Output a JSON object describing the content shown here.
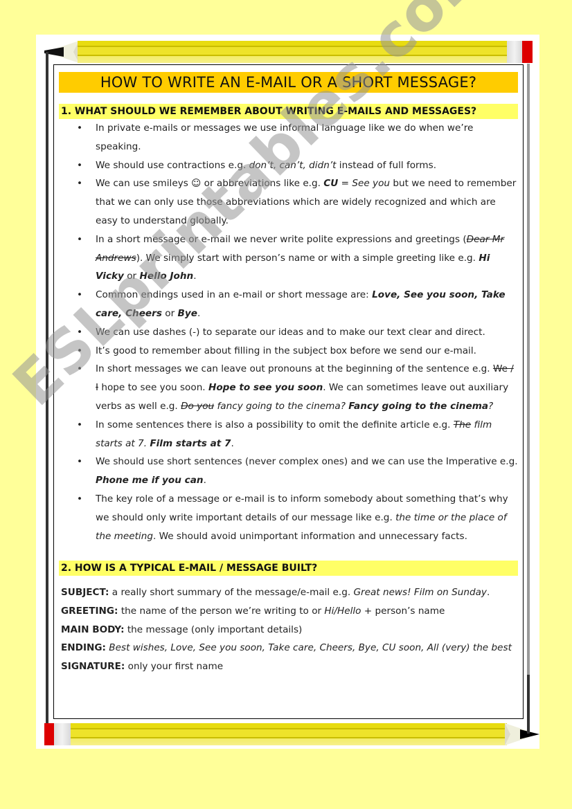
{
  "title": "HOW TO WRITE AN E-MAIL OR A SHORT MESSAGE?",
  "section1": {
    "heading": "1. WHAT SHOULD WE REMEMBER ABOUT WRITING E-MAILS AND MESSAGES?",
    "bullets": [
      {
        "parts": [
          {
            "t": "In private e-mails or messages we use informal language like we do when we’re speaking.",
            "s": "n"
          }
        ]
      },
      {
        "parts": [
          {
            "t": "We should use contractions e.g. ",
            "s": "n"
          },
          {
            "t": "don’t, can’t, didn’t",
            "s": "i"
          },
          {
            "t": " instead of full forms.",
            "s": "n"
          }
        ]
      },
      {
        "parts": [
          {
            "t": "We can use smileys ☺ or abbreviations like e.g. ",
            "s": "n"
          },
          {
            "t": "CU",
            "s": "bi"
          },
          {
            "t": " = ",
            "s": "n"
          },
          {
            "t": "See you",
            "s": "i"
          },
          {
            "t": " but we need to remember that we can only use those abbreviations which are widely recognized and which are easy to understand globally.",
            "s": "n"
          }
        ]
      },
      {
        "parts": [
          {
            "t": "In a short message or e-mail we never write polite expressions and greetings (",
            "s": "n"
          },
          {
            "t": "Dear Mr Andrews",
            "s": "strike"
          },
          {
            "t": "). We simply start with person’s name or with a simple greeting like e.g. ",
            "s": "n"
          },
          {
            "t": "Hi Vicky",
            "s": "bi"
          },
          {
            "t": " or ",
            "s": "n"
          },
          {
            "t": "Hello John",
            "s": "bi"
          },
          {
            "t": ".",
            "s": "n"
          }
        ]
      },
      {
        "parts": [
          {
            "t": "Common endings used in an e-mail or short message are: ",
            "s": "n"
          },
          {
            "t": "Love",
            "s": "bi"
          },
          {
            "t": ", ",
            "s": "bi"
          },
          {
            "t": "See you soon",
            "s": "bi"
          },
          {
            "t": ", ",
            "s": "bi"
          },
          {
            "t": "Take care",
            "s": "bi"
          },
          {
            "t": ", ",
            "s": "bi"
          },
          {
            "t": "Cheers",
            "s": "bi"
          },
          {
            "t": " or ",
            "s": "n"
          },
          {
            "t": "Bye",
            "s": "bi"
          },
          {
            "t": ".",
            "s": "n"
          }
        ]
      },
      {
        "parts": [
          {
            "t": "We can use dashes (-) to separate our ideas and to make our text clear and direct.",
            "s": "n"
          }
        ]
      },
      {
        "parts": [
          {
            "t": "It’s good to remember about filling in the subject box before we send our e-mail.",
            "s": "n"
          }
        ]
      },
      {
        "parts": [
          {
            "t": "In short messages we can leave out pronouns at the beginning of the sentence e.g. ",
            "s": "n"
          },
          {
            "t": "We / I",
            "s": "strike-n"
          },
          {
            "t": " hope to see you soon. ",
            "s": "n"
          },
          {
            "t": "Hope to see you soon",
            "s": "bi"
          },
          {
            "t": ". We can sometimes leave out auxiliary verbs as well e.g. ",
            "s": "n"
          },
          {
            "t": "Do you",
            "s": "strike"
          },
          {
            "t": " fancy going to the cinema? ",
            "s": "i"
          },
          {
            "t": "Fancy going to the cinema",
            "s": "bi"
          },
          {
            "t": "?",
            "s": "i"
          }
        ]
      },
      {
        "parts": [
          {
            "t": "In some sentences there is also a possibility to omit the definite article e.g. ",
            "s": "n"
          },
          {
            "t": "The",
            "s": "strike"
          },
          {
            "t": " film starts at 7. ",
            "s": "i"
          },
          {
            "t": "Film starts at 7",
            "s": "bi"
          },
          {
            "t": ".",
            "s": "n"
          }
        ]
      },
      {
        "parts": [
          {
            "t": "We should use short sentences (never complex ones) and we can use the Imperative e.g. ",
            "s": "n"
          },
          {
            "t": "Phone me if you can",
            "s": "bi"
          },
          {
            "t": ".",
            "s": "n"
          }
        ]
      },
      {
        "parts": [
          {
            "t": "The key role of a message or e-mail is to inform somebody about something that’s why we should only write important details of our message like e.g. ",
            "s": "n"
          },
          {
            "t": "the time or the place of the meeting",
            "s": "i"
          },
          {
            "t": ". We should avoid unimportant information and unnecessary facts.",
            "s": "n"
          }
        ]
      }
    ]
  },
  "section2": {
    "heading": "2. HOW IS A TYPICAL E-MAIL / MESSAGE BUILT?",
    "rows": [
      {
        "label": "SUBJECT:",
        "parts": [
          {
            "t": " a really short summary of the message/e-mail e.g. ",
            "s": "n"
          },
          {
            "t": "Great news! Film on Sunday",
            "s": "i"
          },
          {
            "t": ".",
            "s": "n"
          }
        ]
      },
      {
        "label": "GREETING:",
        "parts": [
          {
            "t": " the name of the person we’re writing to or ",
            "s": "n"
          },
          {
            "t": "Hi/Hello",
            "s": "i"
          },
          {
            "t": " + person’s name",
            "s": "n"
          }
        ]
      },
      {
        "label": "MAIN BODY:",
        "parts": [
          {
            "t": " the message (only important details)",
            "s": "n"
          }
        ]
      },
      {
        "label": "ENDING:",
        "parts": [
          {
            "t": " Best wishes, Love, See you soon, Take care, Cheers, Bye, CU soon, All (very) the best",
            "s": "i"
          }
        ]
      },
      {
        "label": "SIGNATURE:",
        "parts": [
          {
            "t": " only your first name",
            "s": "n"
          }
        ]
      }
    ]
  },
  "watermark": "ESLprintables.com",
  "colors": {
    "background": "#ffff99",
    "title_band": "#ffcc00",
    "section_band": "#ffff66",
    "pencil_yellow": "#eee32a",
    "eraser_red": "#dd0000"
  }
}
